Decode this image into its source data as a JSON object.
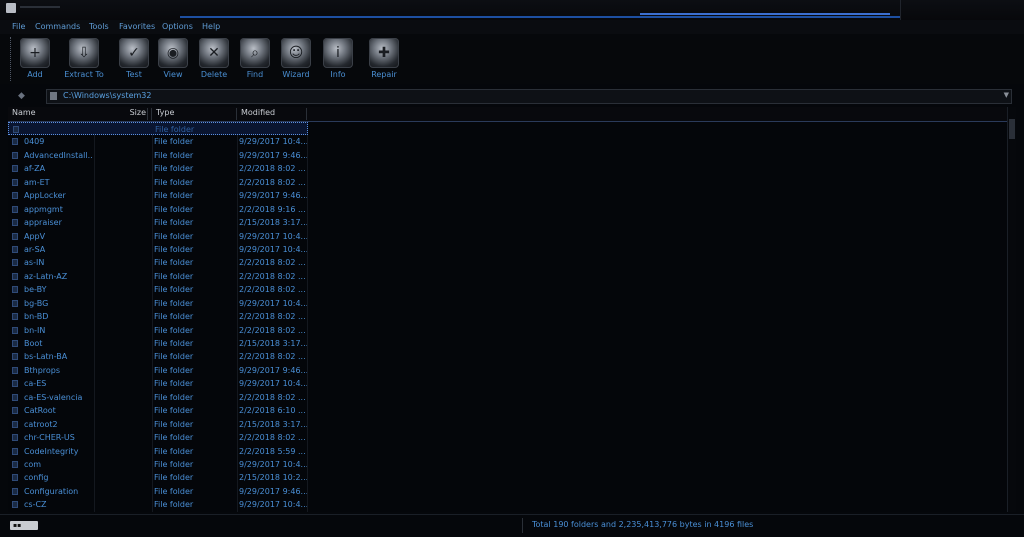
{
  "menu": [
    "File",
    "Commands",
    "Tools",
    "Favorites",
    "Options",
    "Help"
  ],
  "toolbar": [
    {
      "label": "Add",
      "icon": "add-icon"
    },
    {
      "label": "Extract To",
      "icon": "extract-icon"
    },
    {
      "label": "Test",
      "icon": "test-icon"
    },
    {
      "label": "View",
      "icon": "view-icon"
    },
    {
      "label": "Delete",
      "icon": "delete-icon"
    },
    {
      "label": "Find",
      "icon": "find-icon"
    },
    {
      "label": "Wizard",
      "icon": "wizard-icon"
    },
    {
      "label": "Info",
      "icon": "info-icon"
    },
    {
      "label": "Repair",
      "icon": "repair-icon"
    }
  ],
  "address": {
    "path": "C:\\Windows\\system32"
  },
  "columns": {
    "name": "Name",
    "size": "Size",
    "type": "Type",
    "modified": "Modified"
  },
  "parent_row": {
    "type": "File folder"
  },
  "files": [
    {
      "name": "0409",
      "type": "File folder",
      "modified": "9/29/2017 10:4..."
    },
    {
      "name": "AdvancedInstall...",
      "type": "File folder",
      "modified": "9/29/2017 9:46..."
    },
    {
      "name": "af-ZA",
      "type": "File folder",
      "modified": "2/2/2018 8:02 ..."
    },
    {
      "name": "am-ET",
      "type": "File folder",
      "modified": "2/2/2018 8:02 ..."
    },
    {
      "name": "AppLocker",
      "type": "File folder",
      "modified": "9/29/2017 9:46..."
    },
    {
      "name": "appmgmt",
      "type": "File folder",
      "modified": "2/2/2018 9:16 ..."
    },
    {
      "name": "appraiser",
      "type": "File folder",
      "modified": "2/15/2018 3:17..."
    },
    {
      "name": "AppV",
      "type": "File folder",
      "modified": "9/29/2017 10:4..."
    },
    {
      "name": "ar-SA",
      "type": "File folder",
      "modified": "9/29/2017 10:4..."
    },
    {
      "name": "as-IN",
      "type": "File folder",
      "modified": "2/2/2018 8:02 ..."
    },
    {
      "name": "az-Latn-AZ",
      "type": "File folder",
      "modified": "2/2/2018 8:02 ..."
    },
    {
      "name": "be-BY",
      "type": "File folder",
      "modified": "2/2/2018 8:02 ..."
    },
    {
      "name": "bg-BG",
      "type": "File folder",
      "modified": "9/29/2017 10:4..."
    },
    {
      "name": "bn-BD",
      "type": "File folder",
      "modified": "2/2/2018 8:02 ..."
    },
    {
      "name": "bn-IN",
      "type": "File folder",
      "modified": "2/2/2018 8:02 ..."
    },
    {
      "name": "Boot",
      "type": "File folder",
      "modified": "2/15/2018 3:17..."
    },
    {
      "name": "bs-Latn-BA",
      "type": "File folder",
      "modified": "2/2/2018 8:02 ..."
    },
    {
      "name": "Bthprops",
      "type": "File folder",
      "modified": "9/29/2017 9:46..."
    },
    {
      "name": "ca-ES",
      "type": "File folder",
      "modified": "9/29/2017 10:4..."
    },
    {
      "name": "ca-ES-valencia",
      "type": "File folder",
      "modified": "2/2/2018 8:02 ..."
    },
    {
      "name": "CatRoot",
      "type": "File folder",
      "modified": "2/2/2018 6:10 ..."
    },
    {
      "name": "catroot2",
      "type": "File folder",
      "modified": "2/15/2018 3:17..."
    },
    {
      "name": "chr-CHER-US",
      "type": "File folder",
      "modified": "2/2/2018 8:02 ..."
    },
    {
      "name": "CodeIntegrity",
      "type": "File folder",
      "modified": "2/2/2018 5:59 ..."
    },
    {
      "name": "com",
      "type": "File folder",
      "modified": "9/29/2017 10:4..."
    },
    {
      "name": "config",
      "type": "File folder",
      "modified": "2/15/2018 10:2..."
    },
    {
      "name": "Configuration",
      "type": "File folder",
      "modified": "9/29/2017 9:46..."
    },
    {
      "name": "cs-CZ",
      "type": "File folder",
      "modified": "9/29/2017 10:4..."
    }
  ],
  "status": {
    "text": "Total 190 folders and 2,235,413,776 bytes in 4196 files"
  }
}
